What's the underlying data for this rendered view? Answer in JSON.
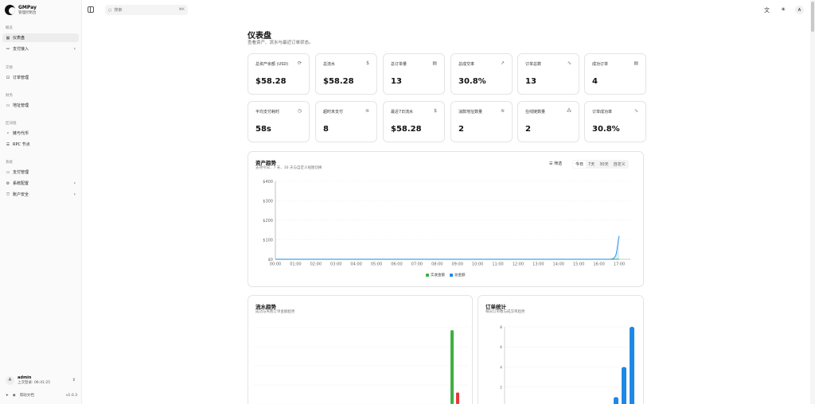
{
  "app": {
    "name": "GMPay",
    "subtitle": "管理控制台"
  },
  "sidebar": {
    "sections": [
      {
        "label": "概览"
      },
      {
        "label": "交易"
      },
      {
        "label": "财务"
      },
      {
        "label": "区块链"
      },
      {
        "label": "系统"
      }
    ],
    "items": [
      {
        "label": "仪表盘",
        "icon": "dashboard-icon",
        "active": true
      },
      {
        "label": "支付接入",
        "icon": "link-icon",
        "expandable": true
      },
      {
        "label": "订单管理",
        "icon": "cart-icon"
      },
      {
        "label": "地址管理",
        "icon": "wallet-icon"
      },
      {
        "label": "链与代币",
        "icon": "coins-icon"
      },
      {
        "label": "RPC 节点",
        "icon": "server-icon"
      },
      {
        "label": "支付管理",
        "icon": "card-icon"
      },
      {
        "label": "系统配置",
        "icon": "gear-icon",
        "expandable": true
      },
      {
        "label": "账户安全",
        "icon": "shield-icon",
        "expandable": true
      }
    ],
    "user": {
      "avatar": "A",
      "name": "admin",
      "last_login": "上次登录: 06:41:25"
    },
    "footer": {
      "docs": "帮助文档",
      "version": "v1.0.3"
    }
  },
  "topbar": {
    "search_placeholder": "搜索",
    "shortcut": "⌘K",
    "avatar": "A"
  },
  "page": {
    "title": "仪表盘",
    "subtitle": "查看资产、流水与最近订单状态。"
  },
  "stats": [
    {
      "label": "总资产余额 (USD)",
      "value": "$58.28",
      "icon": "refresh-icon"
    },
    {
      "label": "总流水",
      "value": "$58.28",
      "icon": "dollar-icon"
    },
    {
      "label": "总订单量",
      "value": "13",
      "icon": "receipt-icon"
    },
    {
      "label": "总成交率",
      "value": "30.8%",
      "icon": "trend-up-icon"
    },
    {
      "label": "订单总数",
      "value": "13",
      "icon": "activity-icon"
    },
    {
      "label": "成功订单",
      "value": "4",
      "icon": "receipt-icon"
    },
    {
      "label": "平均支付耗时",
      "value": "58s",
      "icon": "clock-icon"
    },
    {
      "label": "超时未支付",
      "value": "8",
      "icon": "layers-icon"
    },
    {
      "label": "最近7日流水",
      "value": "$58.28",
      "icon": "dollar-icon"
    },
    {
      "label": "消款地址数量",
      "value": "2",
      "icon": "layers-icon"
    },
    {
      "label": "在线链数量",
      "value": "2",
      "icon": "network-icon"
    },
    {
      "label": "订单成功率",
      "value": "30.8%",
      "icon": "activity-icon"
    }
  ],
  "asset_panel": {
    "title": "资产趋势",
    "subtitle": "支持今日、7 天、30 天与自定义视图切换",
    "filter_label": "筛选",
    "ranges": [
      "今日",
      "7天",
      "30天",
      "自定义"
    ],
    "active_range": "今日"
  },
  "flow_panel": {
    "title": "流水趋势",
    "subtitle": "成功与失败订单金额趋势"
  },
  "order_panel": {
    "title": "订单统计",
    "subtitle": "每日订单数与成交率趋势"
  },
  "colors": {
    "green": "#3cb043",
    "blue": "#1e88e5",
    "red": "#e53935"
  },
  "chart_data": [
    {
      "type": "line",
      "x": [
        "00:00",
        "01:00",
        "02:00",
        "03:00",
        "04:00",
        "05:00",
        "06:00",
        "07:00",
        "08:00",
        "09:00",
        "10:00",
        "11:00",
        "12:00",
        "13:00",
        "14:00",
        "15:00",
        "16:00",
        "17:00"
      ],
      "ytick_labels": [
        "$400",
        "$300",
        "$200",
        "$100",
        "$0"
      ],
      "ylim": [
        0,
        400
      ],
      "series": [
        {
          "name": "实收金额",
          "color": "#3cb043",
          "values": [
            0,
            0,
            0,
            0,
            0,
            0,
            0,
            0,
            0,
            0,
            0,
            0,
            0,
            0,
            0,
            0,
            0,
            0
          ]
        },
        {
          "name": "总金额",
          "color": "#1e88e5",
          "values": [
            0,
            0,
            0,
            0,
            0,
            0,
            0,
            0,
            0,
            0,
            0,
            0,
            0,
            0,
            0,
            0,
            0,
            120
          ]
        }
      ],
      "legend": "bottom",
      "grid": true
    },
    {
      "type": "bar",
      "series": [
        {
          "color": "#3cb043",
          "values": [
            0,
            0,
            0,
            0,
            0,
            0,
            0,
            0,
            0,
            0,
            0,
            0,
            0,
            0,
            0,
            58
          ]
        },
        {
          "color": "#e53935",
          "values": [
            0,
            0,
            0,
            0,
            0,
            0,
            0,
            0,
            0,
            0,
            0,
            0,
            0,
            0,
            0,
            9
          ]
        }
      ]
    },
    {
      "type": "bar",
      "ytick_labels": [
        "8",
        "6",
        "4",
        "2"
      ],
      "ylim": [
        0,
        8
      ],
      "series": [
        {
          "color": "#1e88e5",
          "values": [
            0,
            0,
            0,
            0,
            0,
            0,
            0,
            0,
            0,
            0,
            0,
            0,
            0,
            0,
            0,
            1,
            4,
            8
          ]
        }
      ]
    }
  ]
}
